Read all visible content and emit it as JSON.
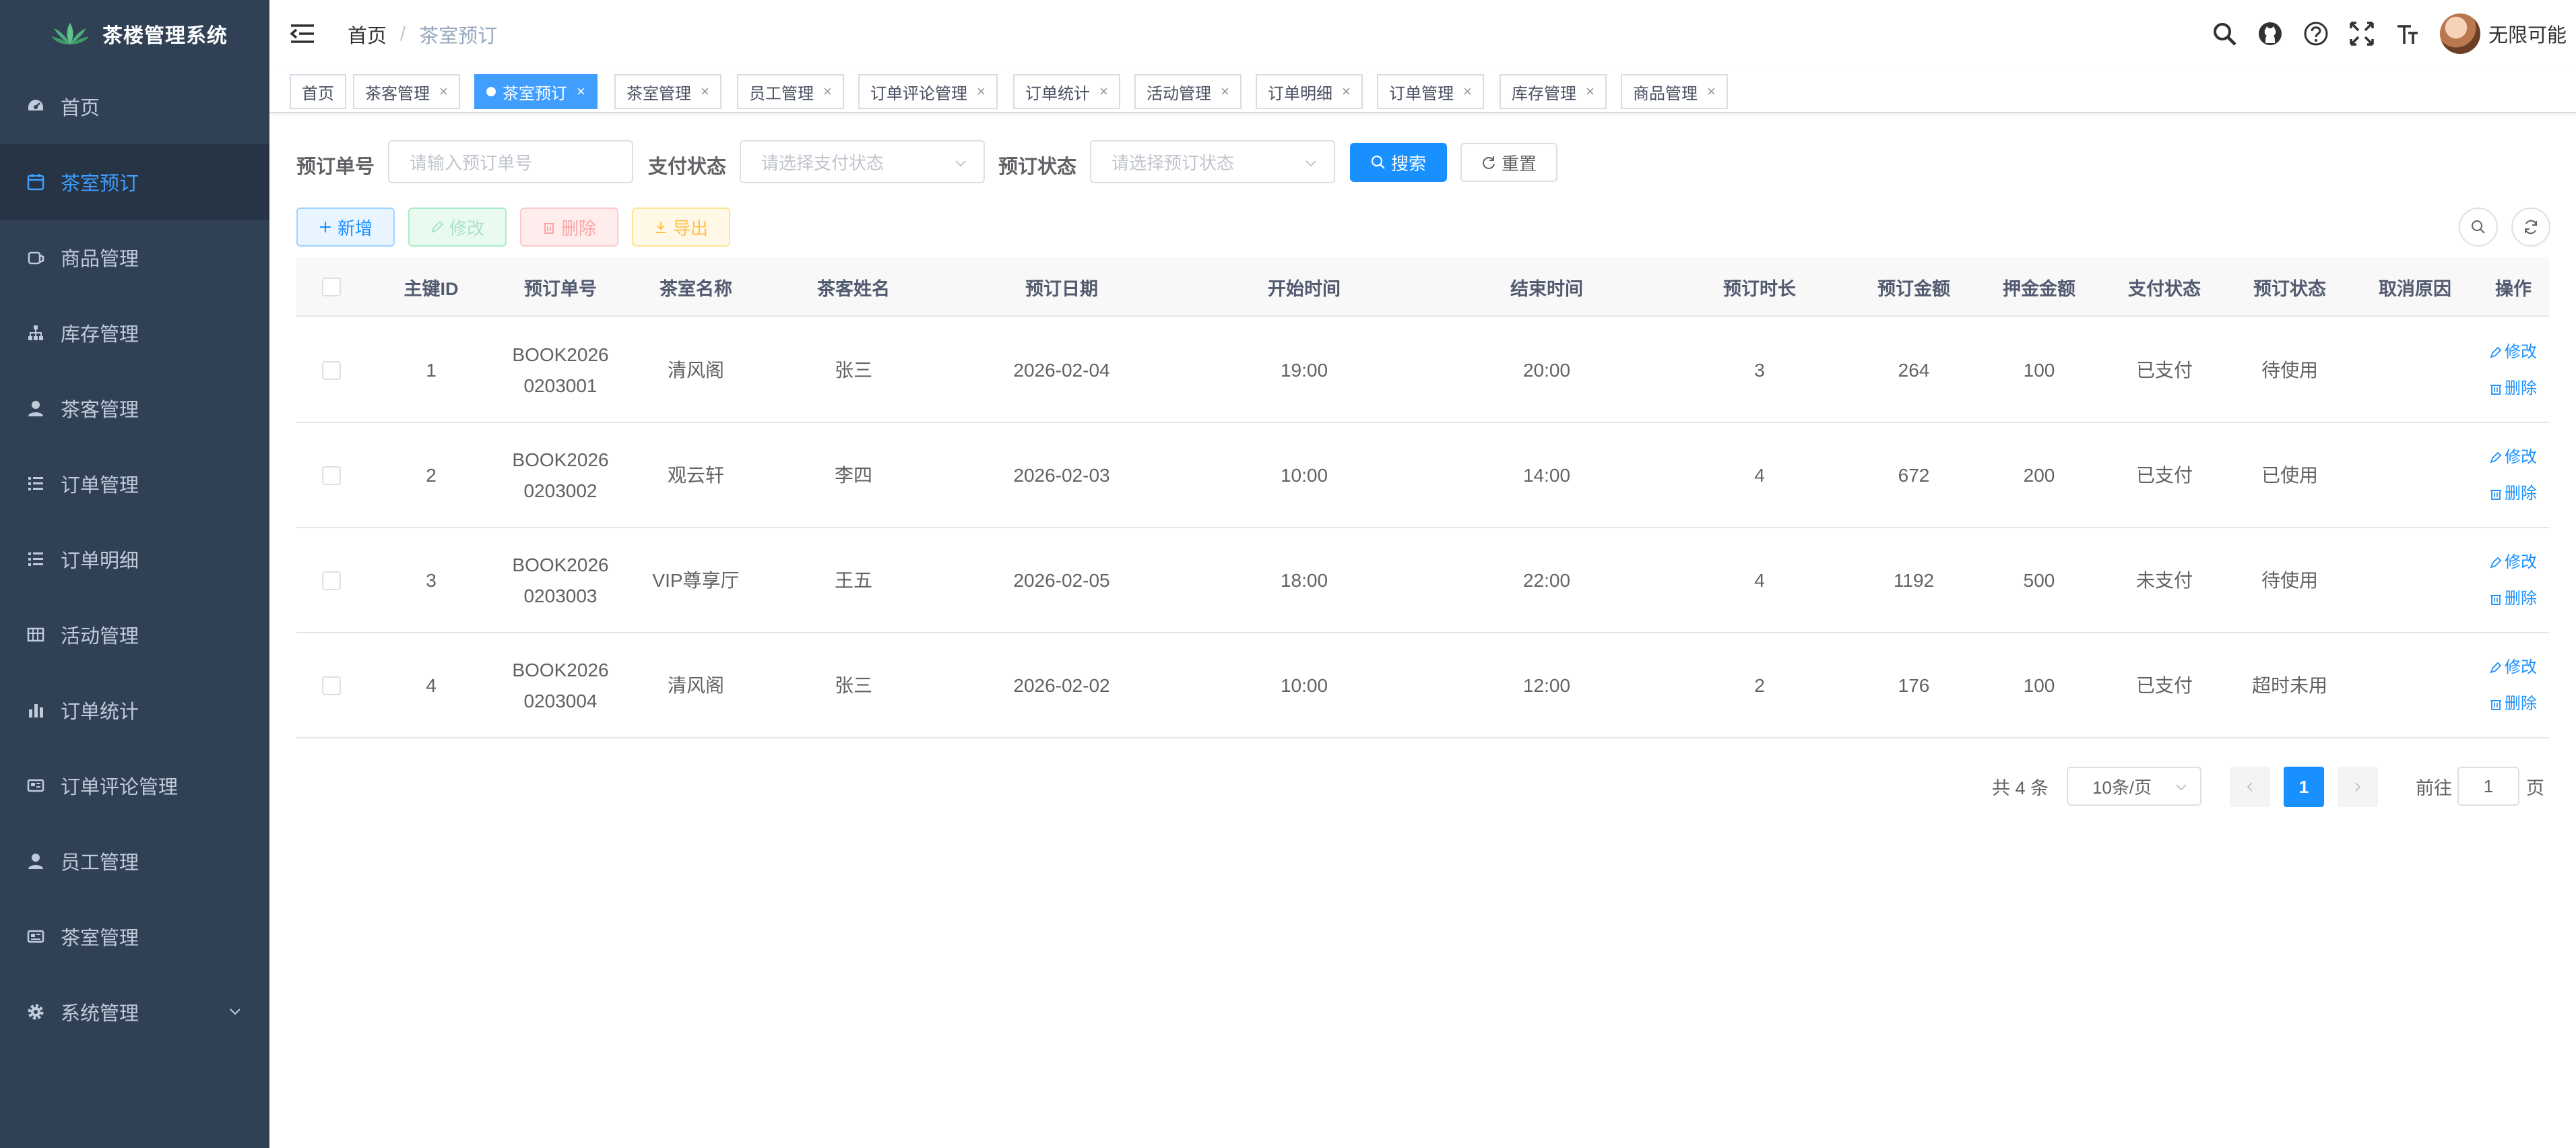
{
  "app": {
    "title": "茶楼管理系统"
  },
  "sidebar": {
    "items": [
      {
        "label": "首页",
        "icon": "dashboard-icon"
      },
      {
        "label": "茶室预订",
        "icon": "calendar-icon",
        "active": true
      },
      {
        "label": "商品管理",
        "icon": "shopping-icon"
      },
      {
        "label": "库存管理",
        "icon": "tree-icon"
      },
      {
        "label": "茶客管理",
        "icon": "user-icon"
      },
      {
        "label": "订单管理",
        "icon": "list-icon"
      },
      {
        "label": "订单明细",
        "icon": "list-icon"
      },
      {
        "label": "活动管理",
        "icon": "table-icon"
      },
      {
        "label": "订单统计",
        "icon": "chart-icon"
      },
      {
        "label": "订单评论管理",
        "icon": "comment-icon"
      },
      {
        "label": "员工管理",
        "icon": "user-icon"
      },
      {
        "label": "茶室管理",
        "icon": "room-icon"
      },
      {
        "label": "系统管理",
        "icon": "gear-icon",
        "has_children": true
      }
    ]
  },
  "navbar": {
    "breadcrumb": {
      "home": "首页",
      "separator": "/",
      "current": "茶室预订"
    },
    "username": "无限可能"
  },
  "tags": [
    {
      "label": "首页"
    },
    {
      "label": "茶客管理"
    },
    {
      "label": "茶室预订",
      "active": true
    },
    {
      "label": "茶室管理"
    },
    {
      "label": "员工管理"
    },
    {
      "label": "订单评论管理"
    },
    {
      "label": "订单统计"
    },
    {
      "label": "活动管理"
    },
    {
      "label": "订单明细"
    },
    {
      "label": "订单管理"
    },
    {
      "label": "库存管理"
    },
    {
      "label": "商品管理"
    }
  ],
  "tag_close": "×",
  "search": {
    "booking_no_label": "预订单号",
    "booking_no_placeholder": "请输入预订单号",
    "pay_status_label": "支付状态",
    "pay_status_placeholder": "请选择支付状态",
    "booking_status_label": "预订状态",
    "booking_status_placeholder": "请选择预订状态",
    "search_button": "搜索",
    "reset_button": "重置"
  },
  "toolbar": {
    "add": "新增",
    "edit": "修改",
    "delete": "删除",
    "export": "导出"
  },
  "table": {
    "columns": [
      "主键ID",
      "预订单号",
      "茶室名称",
      "茶客姓名",
      "预订日期",
      "开始时间",
      "结束时间",
      "预订时长",
      "预订金额",
      "押金金额",
      "支付状态",
      "预订状态",
      "取消原因",
      "操作"
    ],
    "rows": [
      {
        "id": "1",
        "no_line1": "BOOK2026",
        "no_line2": "0203001",
        "room": "清风阁",
        "customer": "张三",
        "date": "2026-02-04",
        "start": "19:00",
        "end": "20:00",
        "duration": "3",
        "amount": "264",
        "deposit": "100",
        "pay_status": "已支付",
        "status": "待使用",
        "cancel_reason": ""
      },
      {
        "id": "2",
        "no_line1": "BOOK2026",
        "no_line2": "0203002",
        "room": "观云轩",
        "customer": "李四",
        "date": "2026-02-03",
        "start": "10:00",
        "end": "14:00",
        "duration": "4",
        "amount": "672",
        "deposit": "200",
        "pay_status": "已支付",
        "status": "已使用",
        "cancel_reason": ""
      },
      {
        "id": "3",
        "no_line1": "BOOK2026",
        "no_line2": "0203003",
        "room": "VIP尊享厅",
        "customer": "王五",
        "date": "2026-02-05",
        "start": "18:00",
        "end": "22:00",
        "duration": "4",
        "amount": "1192",
        "deposit": "500",
        "pay_status": "未支付",
        "status": "待使用",
        "cancel_reason": ""
      },
      {
        "id": "4",
        "no_line1": "BOOK2026",
        "no_line2": "0203004",
        "room": "清风阁",
        "customer": "张三",
        "date": "2026-02-02",
        "start": "10:00",
        "end": "12:00",
        "duration": "2",
        "amount": "176",
        "deposit": "100",
        "pay_status": "已支付",
        "status": "超时未用",
        "cancel_reason": ""
      }
    ],
    "row_edit": "修改",
    "row_delete": "删除"
  },
  "pagination": {
    "total": "共 4 条",
    "page_size": "10条/页",
    "current_page": "1",
    "goto_label": "前往",
    "goto_value": "1",
    "page_unit": "页"
  },
  "colors": {
    "sidebar_bg": "#304156",
    "active_text": "#409eff",
    "primary": "#1890ff"
  }
}
